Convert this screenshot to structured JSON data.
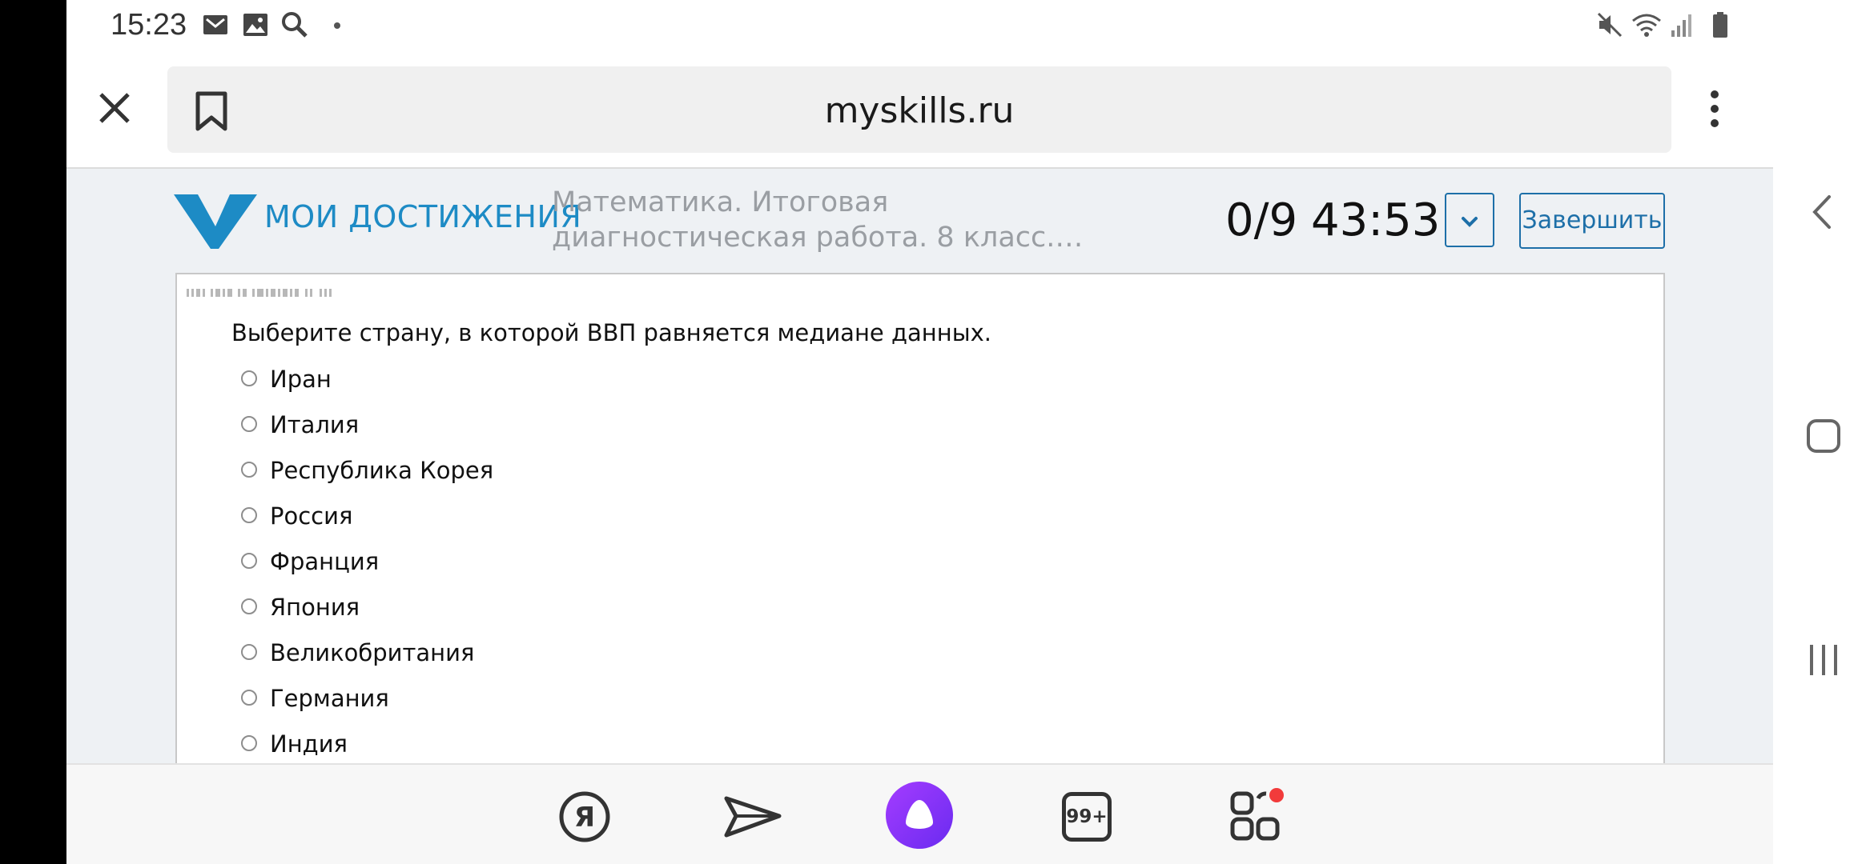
{
  "status_bar": {
    "time": "15:23",
    "left_icons": [
      "mail-icon",
      "image-icon",
      "search-icon",
      "dot-icon"
    ],
    "right_icons": [
      "mute-icon",
      "wifi-icon",
      "signal-icon",
      "battery-icon"
    ]
  },
  "browser": {
    "url": "myskills.ru",
    "icons": [
      "close-icon",
      "bookmark-icon",
      "more-vertical-icon"
    ]
  },
  "site": {
    "logo_text": "МОИ ДОСТИЖЕНИЯ",
    "test_title_line1": "Математика. Итоговая",
    "test_title_line2": "диагностическая работа. 8 класс.…",
    "progress": "0/9",
    "timer": "43:53",
    "finish_label": "Завершить",
    "brand_color": "#1d8bc5"
  },
  "question": {
    "text": "Выберите страну, в которой ВВП равняется медиане данных.",
    "options": [
      {
        "label": "Иран",
        "selected": false
      },
      {
        "label": "Италия",
        "selected": false
      },
      {
        "label": "Республика Корея",
        "selected": false
      },
      {
        "label": "Россия",
        "selected": false
      },
      {
        "label": "Франция",
        "selected": false
      },
      {
        "label": "Япония",
        "selected": false
      },
      {
        "label": "Великобритания",
        "selected": false
      },
      {
        "label": "Германия",
        "selected": false
      },
      {
        "label": "Индия",
        "selected": false
      }
    ]
  },
  "bottom_bar": {
    "notification_count": "99+",
    "icons": [
      "yandex-icon",
      "send-icon",
      "alice-icon",
      "notifications-icon",
      "apps-icon"
    ]
  },
  "nav": {
    "icons": [
      "back-icon",
      "home-icon",
      "recents-icon"
    ]
  }
}
